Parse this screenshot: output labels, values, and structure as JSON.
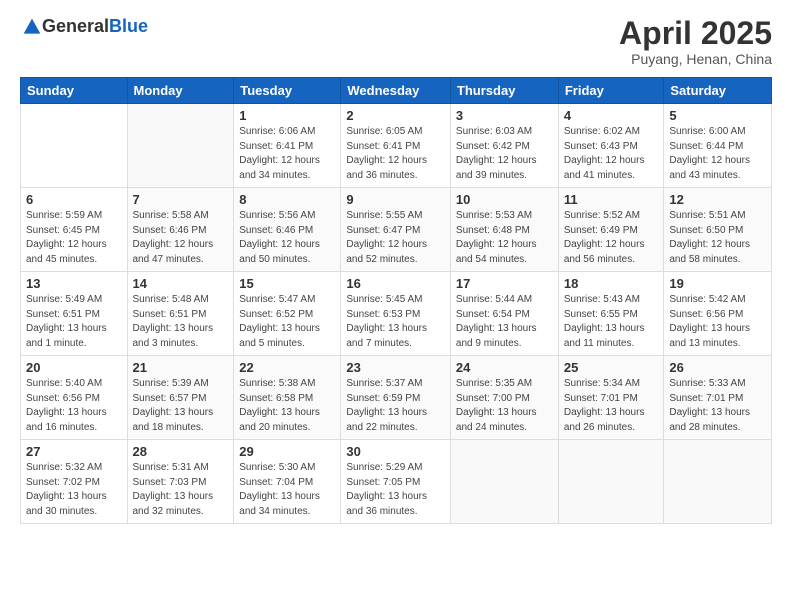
{
  "header": {
    "logo": {
      "general": "General",
      "blue": "Blue"
    },
    "title": "April 2025",
    "location": "Puyang, Henan, China"
  },
  "calendar": {
    "weekdays": [
      "Sunday",
      "Monday",
      "Tuesday",
      "Wednesday",
      "Thursday",
      "Friday",
      "Saturday"
    ],
    "weeks": [
      [
        {
          "day": "",
          "sunrise": "",
          "sunset": "",
          "daylight": ""
        },
        {
          "day": "",
          "sunrise": "",
          "sunset": "",
          "daylight": ""
        },
        {
          "day": "1",
          "sunrise": "Sunrise: 6:06 AM",
          "sunset": "Sunset: 6:41 PM",
          "daylight": "Daylight: 12 hours and 34 minutes."
        },
        {
          "day": "2",
          "sunrise": "Sunrise: 6:05 AM",
          "sunset": "Sunset: 6:41 PM",
          "daylight": "Daylight: 12 hours and 36 minutes."
        },
        {
          "day": "3",
          "sunrise": "Sunrise: 6:03 AM",
          "sunset": "Sunset: 6:42 PM",
          "daylight": "Daylight: 12 hours and 39 minutes."
        },
        {
          "day": "4",
          "sunrise": "Sunrise: 6:02 AM",
          "sunset": "Sunset: 6:43 PM",
          "daylight": "Daylight: 12 hours and 41 minutes."
        },
        {
          "day": "5",
          "sunrise": "Sunrise: 6:00 AM",
          "sunset": "Sunset: 6:44 PM",
          "daylight": "Daylight: 12 hours and 43 minutes."
        }
      ],
      [
        {
          "day": "6",
          "sunrise": "Sunrise: 5:59 AM",
          "sunset": "Sunset: 6:45 PM",
          "daylight": "Daylight: 12 hours and 45 minutes."
        },
        {
          "day": "7",
          "sunrise": "Sunrise: 5:58 AM",
          "sunset": "Sunset: 6:46 PM",
          "daylight": "Daylight: 12 hours and 47 minutes."
        },
        {
          "day": "8",
          "sunrise": "Sunrise: 5:56 AM",
          "sunset": "Sunset: 6:46 PM",
          "daylight": "Daylight: 12 hours and 50 minutes."
        },
        {
          "day": "9",
          "sunrise": "Sunrise: 5:55 AM",
          "sunset": "Sunset: 6:47 PM",
          "daylight": "Daylight: 12 hours and 52 minutes."
        },
        {
          "day": "10",
          "sunrise": "Sunrise: 5:53 AM",
          "sunset": "Sunset: 6:48 PM",
          "daylight": "Daylight: 12 hours and 54 minutes."
        },
        {
          "day": "11",
          "sunrise": "Sunrise: 5:52 AM",
          "sunset": "Sunset: 6:49 PM",
          "daylight": "Daylight: 12 hours and 56 minutes."
        },
        {
          "day": "12",
          "sunrise": "Sunrise: 5:51 AM",
          "sunset": "Sunset: 6:50 PM",
          "daylight": "Daylight: 12 hours and 58 minutes."
        }
      ],
      [
        {
          "day": "13",
          "sunrise": "Sunrise: 5:49 AM",
          "sunset": "Sunset: 6:51 PM",
          "daylight": "Daylight: 13 hours and 1 minute."
        },
        {
          "day": "14",
          "sunrise": "Sunrise: 5:48 AM",
          "sunset": "Sunset: 6:51 PM",
          "daylight": "Daylight: 13 hours and 3 minutes."
        },
        {
          "day": "15",
          "sunrise": "Sunrise: 5:47 AM",
          "sunset": "Sunset: 6:52 PM",
          "daylight": "Daylight: 13 hours and 5 minutes."
        },
        {
          "day": "16",
          "sunrise": "Sunrise: 5:45 AM",
          "sunset": "Sunset: 6:53 PM",
          "daylight": "Daylight: 13 hours and 7 minutes."
        },
        {
          "day": "17",
          "sunrise": "Sunrise: 5:44 AM",
          "sunset": "Sunset: 6:54 PM",
          "daylight": "Daylight: 13 hours and 9 minutes."
        },
        {
          "day": "18",
          "sunrise": "Sunrise: 5:43 AM",
          "sunset": "Sunset: 6:55 PM",
          "daylight": "Daylight: 13 hours and 11 minutes."
        },
        {
          "day": "19",
          "sunrise": "Sunrise: 5:42 AM",
          "sunset": "Sunset: 6:56 PM",
          "daylight": "Daylight: 13 hours and 13 minutes."
        }
      ],
      [
        {
          "day": "20",
          "sunrise": "Sunrise: 5:40 AM",
          "sunset": "Sunset: 6:56 PM",
          "daylight": "Daylight: 13 hours and 16 minutes."
        },
        {
          "day": "21",
          "sunrise": "Sunrise: 5:39 AM",
          "sunset": "Sunset: 6:57 PM",
          "daylight": "Daylight: 13 hours and 18 minutes."
        },
        {
          "day": "22",
          "sunrise": "Sunrise: 5:38 AM",
          "sunset": "Sunset: 6:58 PM",
          "daylight": "Daylight: 13 hours and 20 minutes."
        },
        {
          "day": "23",
          "sunrise": "Sunrise: 5:37 AM",
          "sunset": "Sunset: 6:59 PM",
          "daylight": "Daylight: 13 hours and 22 minutes."
        },
        {
          "day": "24",
          "sunrise": "Sunrise: 5:35 AM",
          "sunset": "Sunset: 7:00 PM",
          "daylight": "Daylight: 13 hours and 24 minutes."
        },
        {
          "day": "25",
          "sunrise": "Sunrise: 5:34 AM",
          "sunset": "Sunset: 7:01 PM",
          "daylight": "Daylight: 13 hours and 26 minutes."
        },
        {
          "day": "26",
          "sunrise": "Sunrise: 5:33 AM",
          "sunset": "Sunset: 7:01 PM",
          "daylight": "Daylight: 13 hours and 28 minutes."
        }
      ],
      [
        {
          "day": "27",
          "sunrise": "Sunrise: 5:32 AM",
          "sunset": "Sunset: 7:02 PM",
          "daylight": "Daylight: 13 hours and 30 minutes."
        },
        {
          "day": "28",
          "sunrise": "Sunrise: 5:31 AM",
          "sunset": "Sunset: 7:03 PM",
          "daylight": "Daylight: 13 hours and 32 minutes."
        },
        {
          "day": "29",
          "sunrise": "Sunrise: 5:30 AM",
          "sunset": "Sunset: 7:04 PM",
          "daylight": "Daylight: 13 hours and 34 minutes."
        },
        {
          "day": "30",
          "sunrise": "Sunrise: 5:29 AM",
          "sunset": "Sunset: 7:05 PM",
          "daylight": "Daylight: 13 hours and 36 minutes."
        },
        {
          "day": "",
          "sunrise": "",
          "sunset": "",
          "daylight": ""
        },
        {
          "day": "",
          "sunrise": "",
          "sunset": "",
          "daylight": ""
        },
        {
          "day": "",
          "sunrise": "",
          "sunset": "",
          "daylight": ""
        }
      ]
    ]
  }
}
